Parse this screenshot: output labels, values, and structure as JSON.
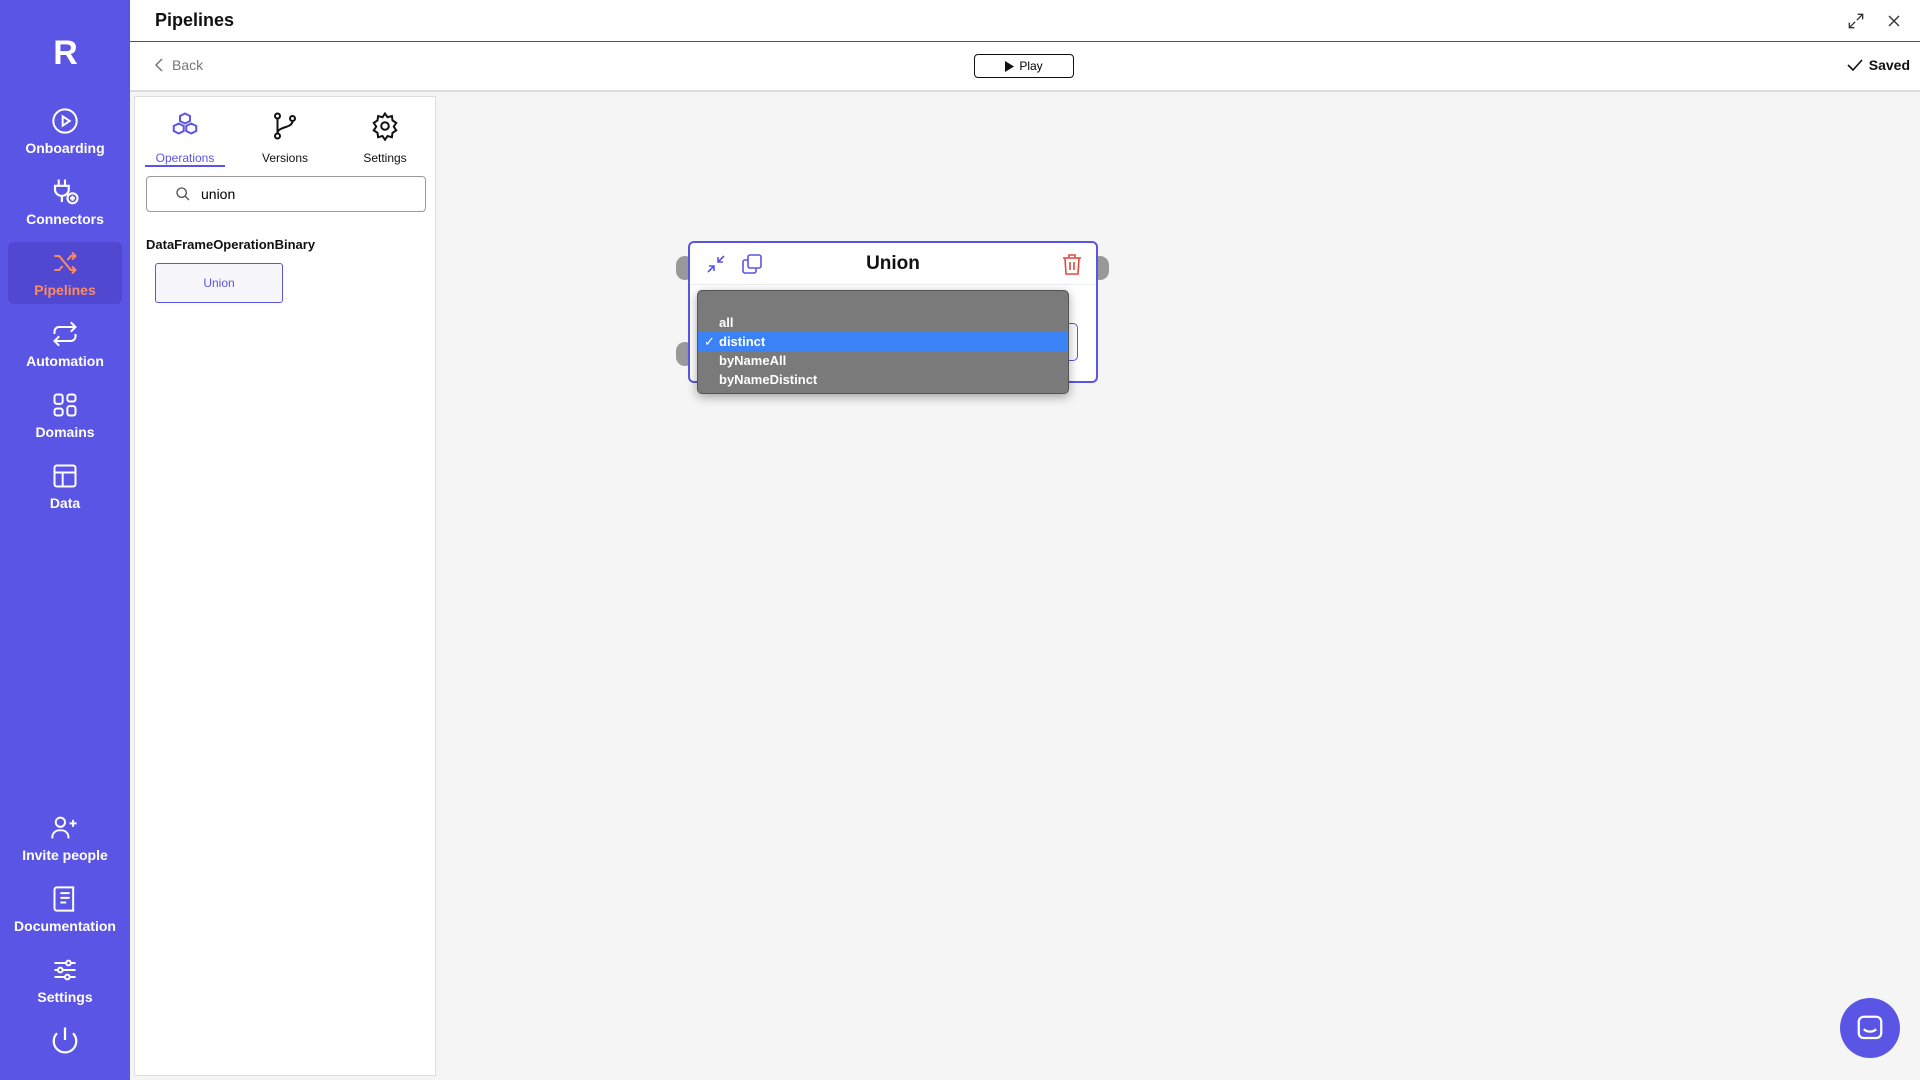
{
  "sidebar": {
    "logo": "R",
    "items": [
      {
        "label": "Onboarding",
        "icon": "play-circle-icon"
      },
      {
        "label": "Connectors",
        "icon": "plug-icon"
      },
      {
        "label": "Pipelines",
        "icon": "shuffle-icon"
      },
      {
        "label": "Automation",
        "icon": "repeat-icon"
      },
      {
        "label": "Domains",
        "icon": "grid-icon"
      },
      {
        "label": "Data",
        "icon": "table-icon"
      }
    ],
    "bottom_items": [
      {
        "label": "Invite people",
        "icon": "user-plus-icon"
      },
      {
        "label": "Documentation",
        "icon": "book-icon"
      },
      {
        "label": "Settings",
        "icon": "sliders-icon"
      }
    ],
    "active": "Pipelines",
    "colors": {
      "bg": "#5b55e6",
      "active_text": "#ff8a5c"
    }
  },
  "header": {
    "title": "Pipelines"
  },
  "toolbar": {
    "back_label": "Back",
    "play_label": "Play",
    "saved_label": "Saved"
  },
  "panel": {
    "tabs": [
      {
        "label": "Operations",
        "icon": "cubes-icon"
      },
      {
        "label": "Versions",
        "icon": "git-branch-icon"
      },
      {
        "label": "Settings",
        "icon": "gear-icon"
      }
    ],
    "active_tab": "Operations",
    "search": {
      "value": "union"
    },
    "category": "DataFrameOperationBinary",
    "operations": [
      "Union"
    ]
  },
  "node": {
    "title": "Union",
    "dropdown": {
      "options": [
        "all",
        "distinct",
        "byNameAll",
        "byNameDistinct"
      ],
      "selected": "distinct",
      "check": "✓"
    }
  }
}
